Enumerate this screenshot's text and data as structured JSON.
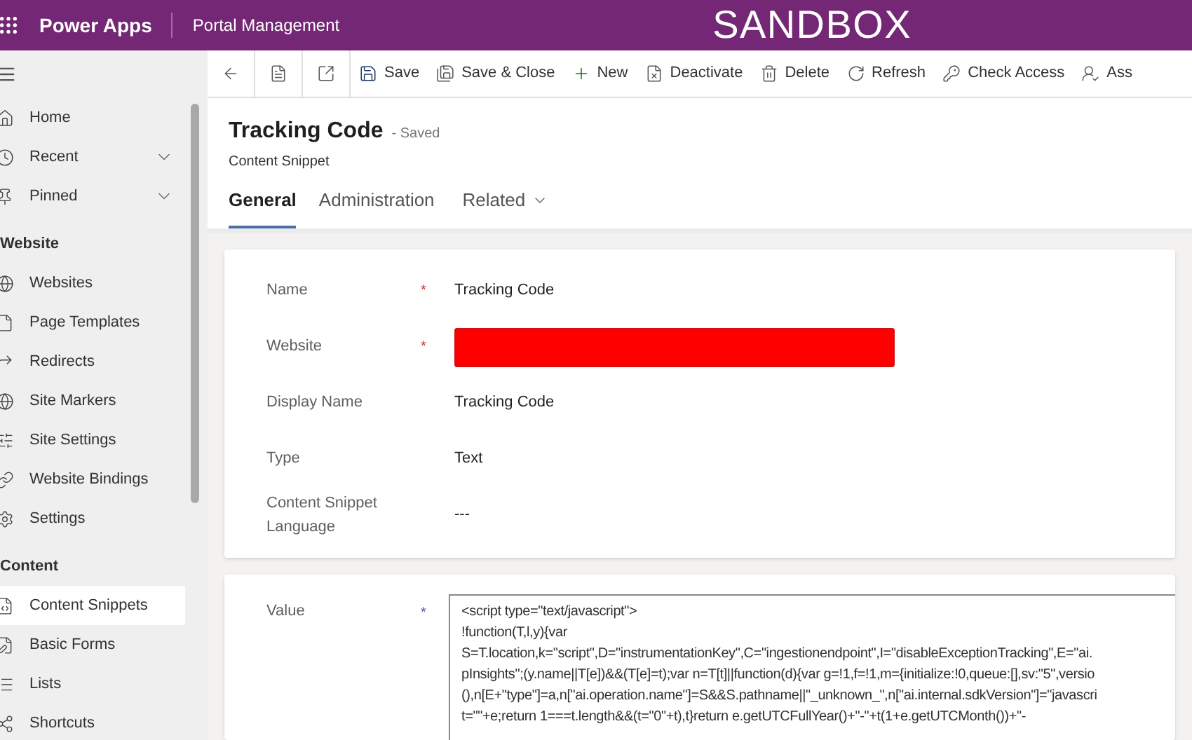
{
  "app_bar": {
    "app_name": "Power Apps",
    "area": "Portal Management",
    "environment": "SANDBOX"
  },
  "command_bar": [
    {
      "kind": "back"
    },
    {
      "kind": "form"
    },
    {
      "kind": "popout"
    },
    {
      "kind": "save",
      "label": "Save"
    },
    {
      "kind": "save-close",
      "label": "Save & Close"
    },
    {
      "kind": "new",
      "label": "New"
    },
    {
      "kind": "deactivate",
      "label": "Deactivate"
    },
    {
      "kind": "delete",
      "label": "Delete"
    },
    {
      "kind": "refresh",
      "label": "Refresh"
    },
    {
      "kind": "check-access",
      "label": "Check Access"
    },
    {
      "kind": "assign",
      "label": "Ass"
    }
  ],
  "sidebar": {
    "items": [
      {
        "kind": "item",
        "label": "Home",
        "selected": false
      },
      {
        "kind": "item",
        "label": "Recent",
        "selected": false,
        "expandable": true
      },
      {
        "kind": "item",
        "label": "Pinned",
        "selected": false,
        "expandable": true
      },
      {
        "kind": "header",
        "label": "Website"
      },
      {
        "kind": "item",
        "label": "Websites",
        "selected": false
      },
      {
        "kind": "item",
        "label": "Page Templates",
        "selected": false
      },
      {
        "kind": "item",
        "label": "Redirects",
        "selected": false
      },
      {
        "kind": "item",
        "label": "Site Markers",
        "selected": false
      },
      {
        "kind": "item",
        "label": "Site Settings",
        "selected": false
      },
      {
        "kind": "item",
        "label": "Website Bindings",
        "selected": false
      },
      {
        "kind": "item",
        "label": "Settings",
        "selected": false
      },
      {
        "kind": "header",
        "label": "Content"
      },
      {
        "kind": "item",
        "label": "Content Snippets",
        "selected": true
      },
      {
        "kind": "item",
        "label": "Basic Forms",
        "selected": false
      },
      {
        "kind": "item",
        "label": "Lists",
        "selected": false
      },
      {
        "kind": "item",
        "label": "Shortcuts",
        "selected": false
      }
    ]
  },
  "record": {
    "title": "Tracking Code",
    "status": "- Saved",
    "entity": "Content Snippet"
  },
  "tabs": [
    {
      "label": "General",
      "selected": true
    },
    {
      "label": "Administration",
      "selected": false
    },
    {
      "label": "Related",
      "selected": false,
      "dropdown": true
    }
  ],
  "fields": [
    {
      "label": "Name",
      "required_marker": "*",
      "kind": "text",
      "value": "Tracking Code"
    },
    {
      "label": "Website",
      "required_marker": "*",
      "kind": "redacted"
    },
    {
      "label": "Display Name",
      "kind": "text",
      "value": "Tracking Code"
    },
    {
      "label": "Type",
      "kind": "text",
      "value": "Text"
    },
    {
      "label": "Content Snippet Language",
      "kind": "text",
      "value": "---"
    }
  ],
  "value_field": {
    "label": "Value",
    "required_marker": "*",
    "lines": [
      "<script type=\"text/javascript\">",
      "!function(T,l,y){var",
      "S=T.location,k=\"script\",D=\"instrumentationKey\",C=\"ingestionendpoint\",I=\"disableExceptionTracking\",E=\"ai.",
      "pInsights\";(y.name||T[e])&&(T[e]=t);var n=T[t]||function(d){var g=!1,f=!1,m={initialize:!0,queue:[],sv:\"5\",versio",
      "(),n[E+\"type\"]=a,n[\"ai.operation.name\"]=S&&S.pathname||\"_unknown_\",n[\"ai.internal.sdkVersion\"]=\"javascri",
      "t=\"\"+e;return 1===t.length&&(t=\"0\"+t),t}return e.getUTCFullYear()+\"-\"+t(1+e.getUTCMonth())+\"-"
    ]
  }
}
